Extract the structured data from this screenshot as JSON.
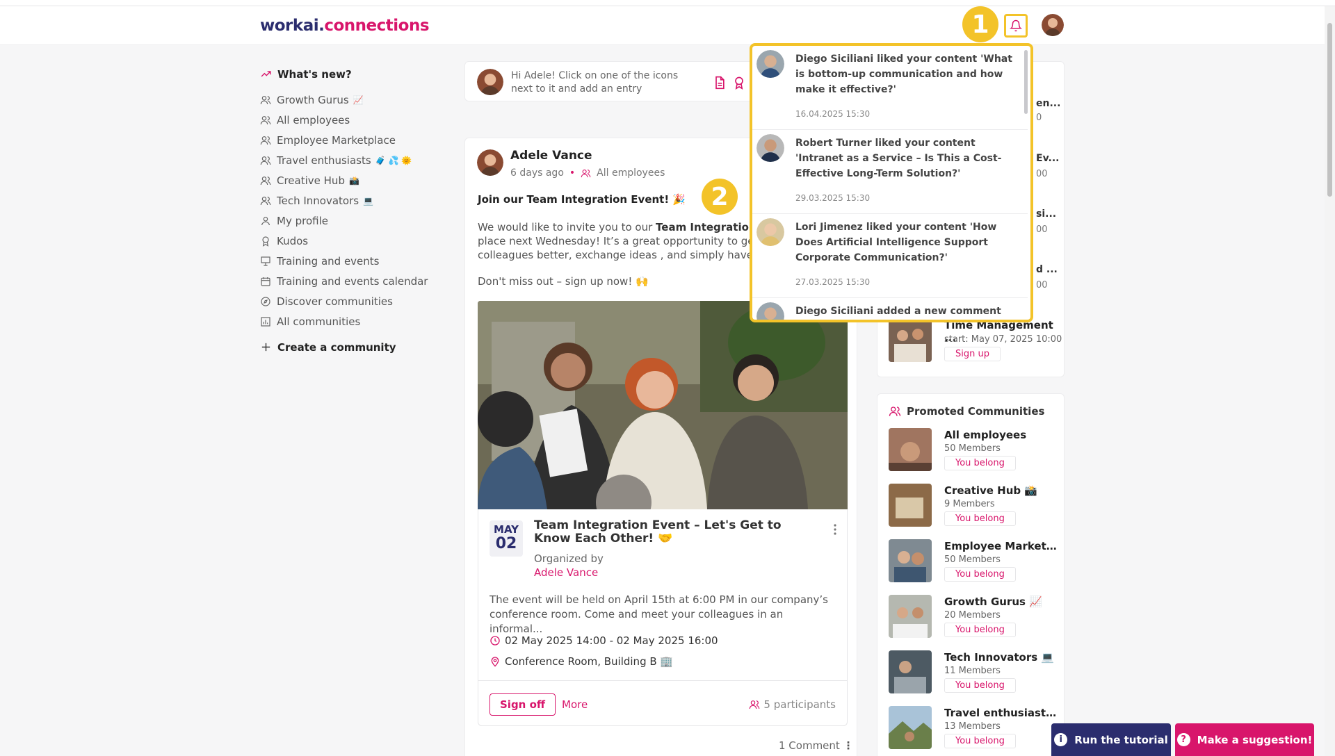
{
  "app": {
    "logo_part1": "workai.",
    "logo_part2": "connections",
    "brand_color": "#d8156b",
    "navy": "#2b2d6e",
    "highlight": "#f3c329"
  },
  "tutorial_markers": [
    "1",
    "2"
  ],
  "nav": {
    "head": "What's new?",
    "items": [
      {
        "label": "Growth Gurus",
        "emoji": "📈",
        "icon": "people-icon"
      },
      {
        "label": "All employees",
        "emoji": "",
        "icon": "people-icon"
      },
      {
        "label": "Employee Marketplace",
        "emoji": "",
        "icon": "people-icon"
      },
      {
        "label": "Travel enthusiasts",
        "emoji": "🧳 💦 🌞",
        "icon": "people-icon"
      },
      {
        "label": "Creative Hub",
        "emoji": "📸",
        "icon": "people-icon"
      },
      {
        "label": "Tech Innovators",
        "emoji": "💻",
        "icon": "people-icon"
      },
      {
        "label": "My profile",
        "emoji": "",
        "icon": "person-icon"
      },
      {
        "label": "Kudos",
        "emoji": "",
        "icon": "award-icon"
      },
      {
        "label": "Training and events",
        "emoji": "",
        "icon": "presentation-icon"
      },
      {
        "label": "Training and events calendar",
        "emoji": "",
        "icon": "calendar-icon"
      },
      {
        "label": "Discover communities",
        "emoji": "",
        "icon": "compass-icon"
      },
      {
        "label": "All communities",
        "emoji": "",
        "icon": "chart-icon"
      }
    ],
    "create": "Create a community"
  },
  "composer": {
    "text": "Hi Adele! Click on one of the icons next to it and add an entry"
  },
  "post": {
    "author": "Adele Vance",
    "time": "6 days ago",
    "audience": "All employees",
    "title": "Join our Team Integration Event! 🎉",
    "body_line1_pre": "We would like to invite you to our ",
    "body_line1_bold": "Team Integration Even",
    "body_line2": "place next Wednesday! It’s a great opportunity to get to",
    "body_line3": "colleagues better, exchange ideas , and simply have a g",
    "cta": "Don't miss out – sign up now! 🙌",
    "event": {
      "month": "MAY",
      "day": "02",
      "title": "Team Integration Event – Let's Get to Know Each Other! 🤝",
      "organized_by": "Organized by",
      "organizer": "Adele Vance",
      "description": "The event will be held on April 15th at 6:00 PM in our company’s conference room. Come and meet your colleagues in an informal...",
      "datetime": "02 May 2025 14:00 - 02 May 2025 16:00",
      "location": "Conference Room, Building B 🏢",
      "signoff": "Sign off",
      "more": "More",
      "participants": "5 participants"
    },
    "comments": "1 Comment"
  },
  "right_peek": [
    {
      "title": "en...",
      "sub": "0"
    },
    {
      "title": "Ev...",
      "sub": "00"
    },
    {
      "title": "si...",
      "sub": "00"
    },
    {
      "title": "d ...",
      "sub": "00"
    }
  ],
  "training": {
    "title": "Time Management ...",
    "start": "start: May 07, 2025 10:00",
    "signup": "Sign up"
  },
  "promoted": {
    "head": "Promoted Communities",
    "items": [
      {
        "name": "All employees",
        "members": "50 Members",
        "status": "You belong"
      },
      {
        "name": "Creative Hub 📸",
        "members": "9 Members",
        "status": "You belong"
      },
      {
        "name": "Employee Marketpla...",
        "members": "50 Members",
        "status": "You belong"
      },
      {
        "name": "Growth Gurus 📈",
        "members": "20 Members",
        "status": "You belong"
      },
      {
        "name": "Tech Innovators 💻",
        "members": "11 Members",
        "status": "You belong"
      },
      {
        "name": "Travel enthusiasts ...",
        "members": "13 Members",
        "status": "You belong"
      }
    ]
  },
  "notifications": [
    {
      "text": "Diego Siciliani liked your content 'What is bottom-up communication and how make it effective?'",
      "date": "16.04.2025 15:30"
    },
    {
      "text": "Robert Turner liked your content 'Intranet as a Service – Is This a Cost-Effective Long-Term Solution?'",
      "date": "29.03.2025 15:30"
    },
    {
      "text": "Lori Jimenez liked your content 'How Does Artificial Intelligence Support Corporate Communication?'",
      "date": "27.03.2025 15:30"
    },
    {
      "text": "Diego Siciliani added a new comment on",
      "date": ""
    }
  ],
  "buttons": {
    "tutorial": "Run the tutorial",
    "suggest": "Make a suggestion!"
  }
}
